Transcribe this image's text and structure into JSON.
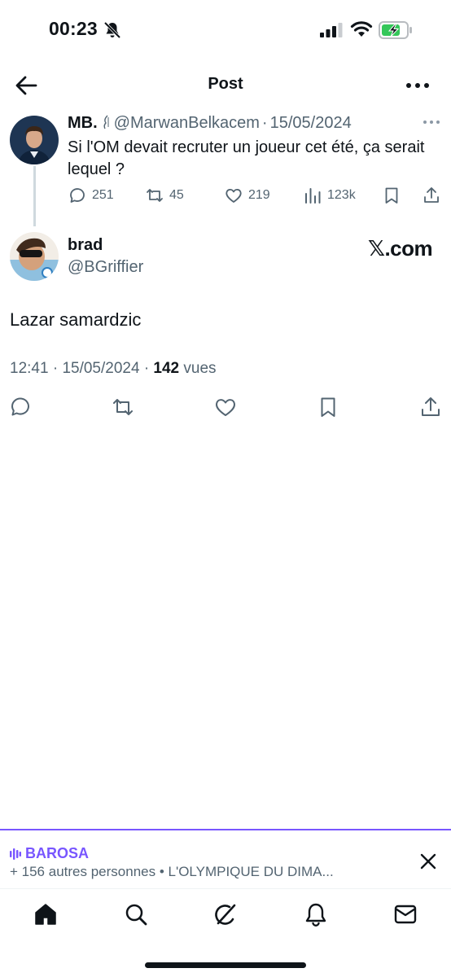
{
  "status_bar": {
    "time": "00:23"
  },
  "header": {
    "title": "Post"
  },
  "quoted_tweet": {
    "name": "MB.",
    "handle": "@MarwanBelkacem",
    "separator": "·",
    "date": "15/05/2024",
    "text": "Si l'OM devait recruter un joueur cet été, ça serait lequel ?",
    "replies": "251",
    "retweets": "45",
    "likes": "219",
    "views": "123k"
  },
  "tweet": {
    "name": "brad",
    "handle": "@BGriffier",
    "watermark": "𝕏.com",
    "text": "Lazar samardzic",
    "time": "12:41",
    "date": "15/05/2024",
    "views_count": "142",
    "views_label": "vues"
  },
  "space_bar": {
    "host": "BAROSA",
    "subtitle": "+ 156 autres personnes • L'OLYMPIQUE DU DIMA..."
  },
  "colors": {
    "accent": "#7856ff",
    "muted": "#536471",
    "text": "#0f1419",
    "battery_fill": "#34c759"
  }
}
